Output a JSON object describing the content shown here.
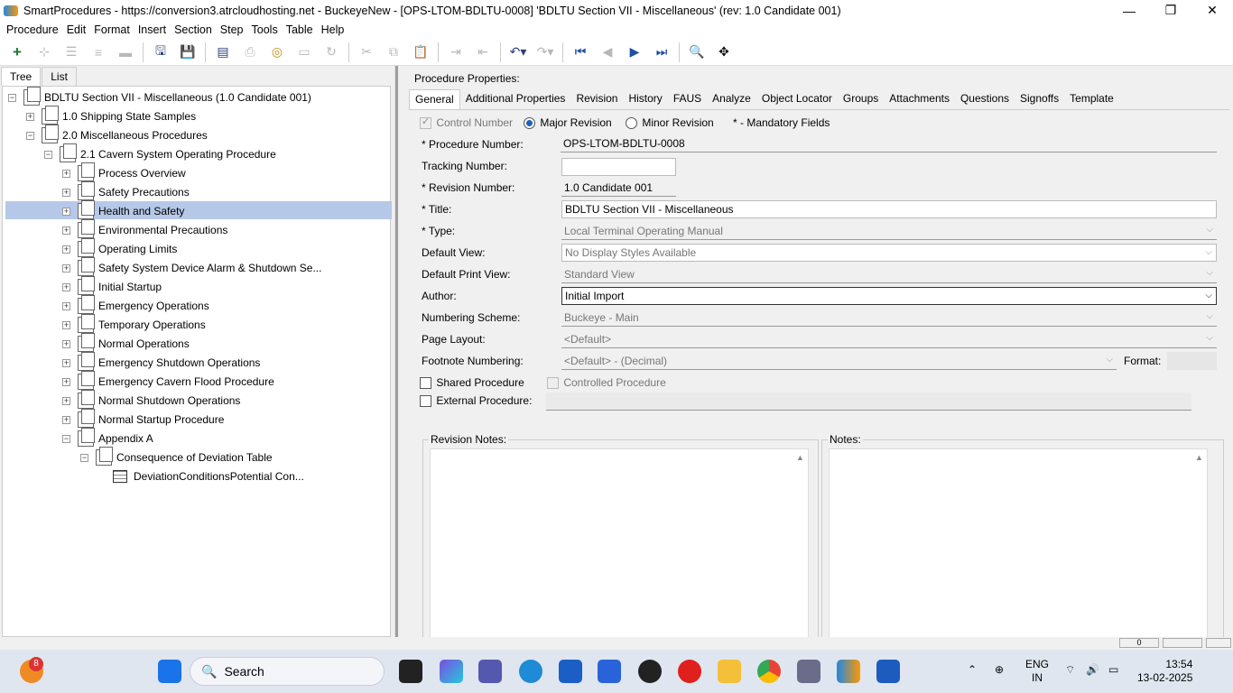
{
  "window": {
    "title": "SmartProcedures - https://conversion3.atrcloudhosting.net - BuckeyeNew - [OPS-LTOM-BDLTU-0008] 'BDLTU Section VII - Miscellaneous' (rev: 1.0 Candidate 001)",
    "minimize": "—",
    "maximize": "❐",
    "close": "✕"
  },
  "menu": [
    "Procedure",
    "Edit",
    "Format",
    "Insert",
    "Section",
    "Step",
    "Tools",
    "Table",
    "Help"
  ],
  "toolbar_icons": [
    "add-icon",
    "add-child-icon",
    "indent-list-icon",
    "outdent-list-icon",
    "remove-icon",
    "save-all-icon",
    "save-icon",
    "publish-icon",
    "print-icon",
    "refresh-icon",
    "properties-icon",
    "redo-special-icon",
    "cut-icon",
    "copy-icon",
    "paste-icon",
    "indent-icon",
    "outdent-icon",
    "undo-icon",
    "redo-icon",
    "first-icon",
    "previous-icon",
    "next-icon",
    "last-icon",
    "find-icon",
    "move-icon"
  ],
  "left": {
    "tabs": [
      "Tree",
      "List"
    ],
    "tree": [
      {
        "label": "BDLTU Section VII - Miscellaneous (1.0 Candidate 001)",
        "exp": "−",
        "level": 0
      },
      {
        "label": "1.0 Shipping State Samples",
        "exp": "+",
        "level": 1
      },
      {
        "label": "2.0 Miscellaneous Procedures",
        "exp": "−",
        "level": 1
      },
      {
        "label": "2.1 Cavern System Operating Procedure",
        "exp": "−",
        "level": 2
      },
      {
        "label": "Process Overview",
        "exp": "+",
        "level": 3
      },
      {
        "label": "Safety Precautions",
        "exp": "+",
        "level": 3
      },
      {
        "label": "Health and Safety",
        "exp": "+",
        "level": 3
      },
      {
        "label": "Environmental Precautions",
        "exp": "+",
        "level": 3
      },
      {
        "label": "Operating Limits",
        "exp": "+",
        "level": 3
      },
      {
        "label": "Safety System Device Alarm & Shutdown Se...",
        "exp": "+",
        "level": 3
      },
      {
        "label": "Initial Startup",
        "exp": "+",
        "level": 3
      },
      {
        "label": "Emergency Operations",
        "exp": "+",
        "level": 3
      },
      {
        "label": "Temporary Operations",
        "exp": "+",
        "level": 3
      },
      {
        "label": "Normal Operations",
        "exp": "+",
        "level": 3
      },
      {
        "label": "Emergency Shutdown Operations",
        "exp": "+",
        "level": 3
      },
      {
        "label": "Emergency Cavern Flood Procedure",
        "exp": "+",
        "level": 3
      },
      {
        "label": "Normal Shutdown Operations",
        "exp": "+",
        "level": 3
      },
      {
        "label": "Normal Startup Procedure",
        "exp": "+",
        "level": 3
      },
      {
        "label": "Appendix A",
        "exp": "−",
        "level": 3
      },
      {
        "label": "Consequence of Deviation Table",
        "exp": "−",
        "level": 4
      },
      {
        "label": "DeviationConditionsPotential Con...",
        "exp": "",
        "level": 5
      }
    ]
  },
  "right": {
    "panel_title": "Procedure Properties:",
    "tabs": [
      "General",
      "Additional Properties",
      "Revision",
      "History",
      "FAUS",
      "Analyze",
      "Object Locator",
      "Groups",
      "Attachments",
      "Questions",
      "Signoffs",
      "Template"
    ],
    "control_number": "Control Number",
    "major_revision": "Major Revision",
    "minor_revision": "Minor Revision",
    "mandatory": "* - Mandatory Fields",
    "fields": {
      "procedure_number_label": "* Procedure Number:",
      "procedure_number": "OPS-LTOM-BDLTU-0008",
      "tracking_number_label": "Tracking Number:",
      "tracking_number": "",
      "revision_number_label": "* Revision Number:",
      "revision_number": "1.0 Candidate 001",
      "title_label": "* Title:",
      "title": "BDLTU Section VII - Miscellaneous",
      "type_label": "* Type:",
      "type": "Local Terminal Operating Manual",
      "default_view_label": "Default View:",
      "default_view": "No Display Styles Available",
      "default_print_view_label": "Default Print View:",
      "default_print_view": "Standard View",
      "author_label": "Author:",
      "author": "Initial Import",
      "numbering_scheme_label": "Numbering Scheme:",
      "numbering_scheme": "Buckeye - Main",
      "page_layout_label": "Page Layout:",
      "page_layout": "<Default>",
      "footnote_numbering_label": "Footnote Numbering:",
      "footnote_numbering": "<Default> - (Decimal)",
      "format_label": "Format:",
      "shared_procedure": "Shared Procedure",
      "controlled_procedure": "Controlled Procedure",
      "external_procedure": "External Procedure:"
    },
    "revision_notes": "Revision Notes:",
    "notes": "Notes:"
  },
  "statusbar": {
    "field": "0"
  },
  "taskbar": {
    "search": "Search",
    "badge": "8",
    "lang1": "ENG",
    "lang2": "IN",
    "time": "13:54",
    "date": "13-02-2025"
  }
}
